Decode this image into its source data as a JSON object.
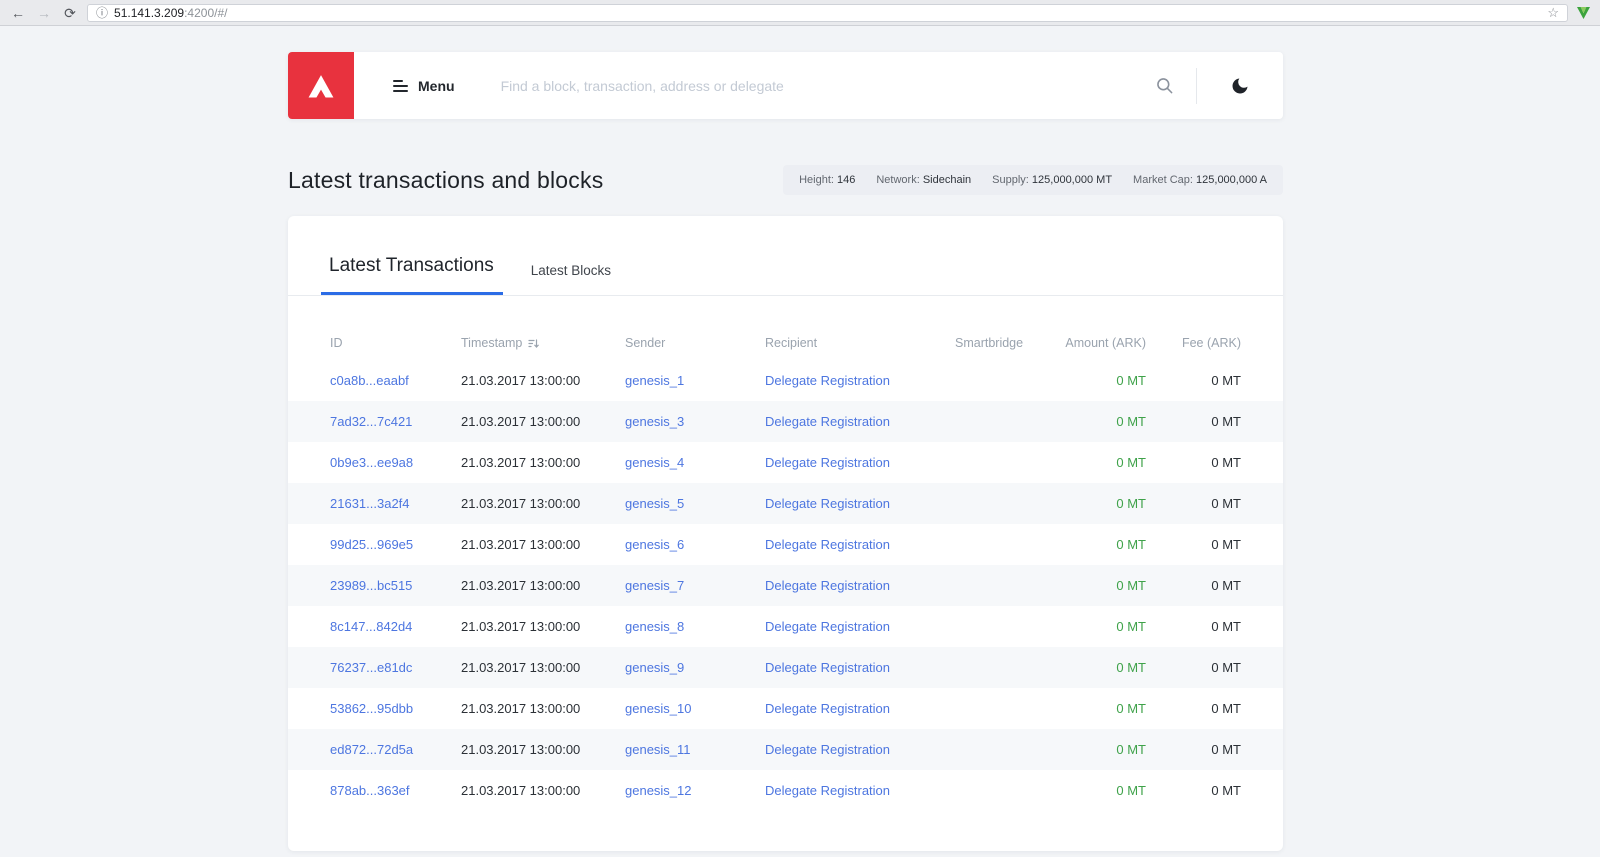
{
  "colors": {
    "accent_red": "#e8323e",
    "link_blue": "#4d76e0",
    "amount_green": "#3fa24a",
    "tab_blue": "#2b6ce6"
  },
  "browser": {
    "url_host": "51.141.3.209",
    "url_path": ":4200/#/"
  },
  "header": {
    "menu_label": "Menu",
    "search_placeholder": "Find a block, transaction, address or delegate"
  },
  "page": {
    "title": "Latest transactions and blocks",
    "stats": [
      {
        "label": "Height:",
        "value": "146"
      },
      {
        "label": "Network:",
        "value": "Sidechain"
      },
      {
        "label": "Supply:",
        "value": "125,000,000 MT"
      },
      {
        "label": "Market Cap:",
        "value": "125,000,000 A"
      }
    ]
  },
  "tabs": {
    "transactions": "Latest Transactions",
    "blocks": "Latest Blocks"
  },
  "table": {
    "columns": [
      "ID",
      "Timestamp",
      "Sender",
      "Recipient",
      "Smartbridge",
      "Amount (ARK)",
      "Fee (ARK)"
    ],
    "rows": [
      {
        "id": "c0a8b...eaabf",
        "timestamp": "21.03.2017 13:00:00",
        "sender": "genesis_1",
        "recipient": "Delegate Registration",
        "smartbridge": "",
        "amount": "0 MT",
        "fee": "0 MT"
      },
      {
        "id": "7ad32...7c421",
        "timestamp": "21.03.2017 13:00:00",
        "sender": "genesis_3",
        "recipient": "Delegate Registration",
        "smartbridge": "",
        "amount": "0 MT",
        "fee": "0 MT"
      },
      {
        "id": "0b9e3...ee9a8",
        "timestamp": "21.03.2017 13:00:00",
        "sender": "genesis_4",
        "recipient": "Delegate Registration",
        "smartbridge": "",
        "amount": "0 MT",
        "fee": "0 MT"
      },
      {
        "id": "21631...3a2f4",
        "timestamp": "21.03.2017 13:00:00",
        "sender": "genesis_5",
        "recipient": "Delegate Registration",
        "smartbridge": "",
        "amount": "0 MT",
        "fee": "0 MT"
      },
      {
        "id": "99d25...969e5",
        "timestamp": "21.03.2017 13:00:00",
        "sender": "genesis_6",
        "recipient": "Delegate Registration",
        "smartbridge": "",
        "amount": "0 MT",
        "fee": "0 MT"
      },
      {
        "id": "23989...bc515",
        "timestamp": "21.03.2017 13:00:00",
        "sender": "genesis_7",
        "recipient": "Delegate Registration",
        "smartbridge": "",
        "amount": "0 MT",
        "fee": "0 MT"
      },
      {
        "id": "8c147...842d4",
        "timestamp": "21.03.2017 13:00:00",
        "sender": "genesis_8",
        "recipient": "Delegate Registration",
        "smartbridge": "",
        "amount": "0 MT",
        "fee": "0 MT"
      },
      {
        "id": "76237...e81dc",
        "timestamp": "21.03.2017 13:00:00",
        "sender": "genesis_9",
        "recipient": "Delegate Registration",
        "smartbridge": "",
        "amount": "0 MT",
        "fee": "0 MT"
      },
      {
        "id": "53862...95dbb",
        "timestamp": "21.03.2017 13:00:00",
        "sender": "genesis_10",
        "recipient": "Delegate Registration",
        "smartbridge": "",
        "amount": "0 MT",
        "fee": "0 MT"
      },
      {
        "id": "ed872...72d5a",
        "timestamp": "21.03.2017 13:00:00",
        "sender": "genesis_11",
        "recipient": "Delegate Registration",
        "smartbridge": "",
        "amount": "0 MT",
        "fee": "0 MT"
      },
      {
        "id": "878ab...363ef",
        "timestamp": "21.03.2017 13:00:00",
        "sender": "genesis_12",
        "recipient": "Delegate Registration",
        "smartbridge": "",
        "amount": "0 MT",
        "fee": "0 MT"
      }
    ]
  }
}
